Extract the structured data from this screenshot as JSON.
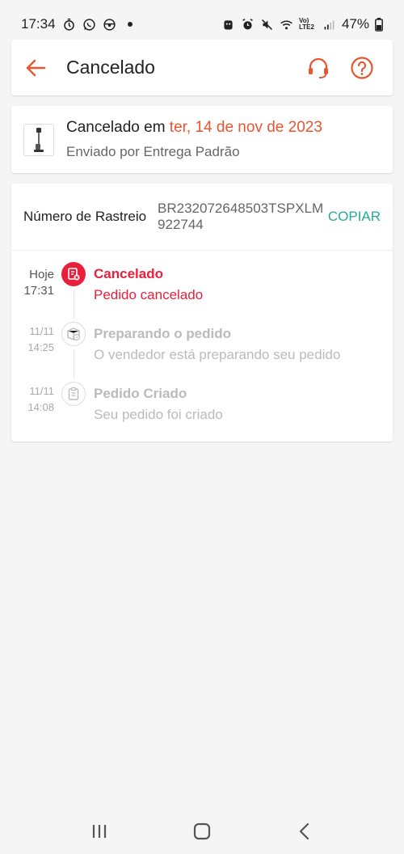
{
  "status_bar": {
    "time": "17:34",
    "network": "Vo) LTE2",
    "battery": "47%"
  },
  "header": {
    "title": "Cancelado",
    "back_icon": "arrow-left-icon",
    "support_icon": "headset-icon",
    "help_icon": "help-circle-icon",
    "accent_color": "#e8552f"
  },
  "summary": {
    "status_prefix": "Cancelado em ",
    "status_date": "ter, 14 de nov de 2023",
    "shipping": "Enviado por Entrega Padrão",
    "thumbnail_icon": "product-thumbnail"
  },
  "tracking": {
    "label": "Número de Rastreio",
    "number": "BR232072648503TSPXLM922744",
    "copy_label": "COPIAR",
    "copy_color": "#26aa99"
  },
  "timeline": [
    {
      "time_line1": "Hoje",
      "time_line2": "17:31",
      "title": "Cancelado",
      "description": "Pedido cancelado",
      "icon": "cancel-order-icon",
      "active": true
    },
    {
      "time_line1": "11/11",
      "time_line2": "14:25",
      "title": "Preparando o pedido",
      "description": "O vendedor está preparando seu pedido",
      "icon": "preparing-box-icon",
      "active": false
    },
    {
      "time_line1": "11/11",
      "time_line2": "14:08",
      "title": "Pedido Criado",
      "description": "Seu pedido foi criado",
      "icon": "clipboard-icon",
      "active": false
    }
  ],
  "nav_bar": {
    "recents_icon": "recents-icon",
    "home_icon": "home-icon",
    "back_icon": "back-chevron-icon"
  }
}
